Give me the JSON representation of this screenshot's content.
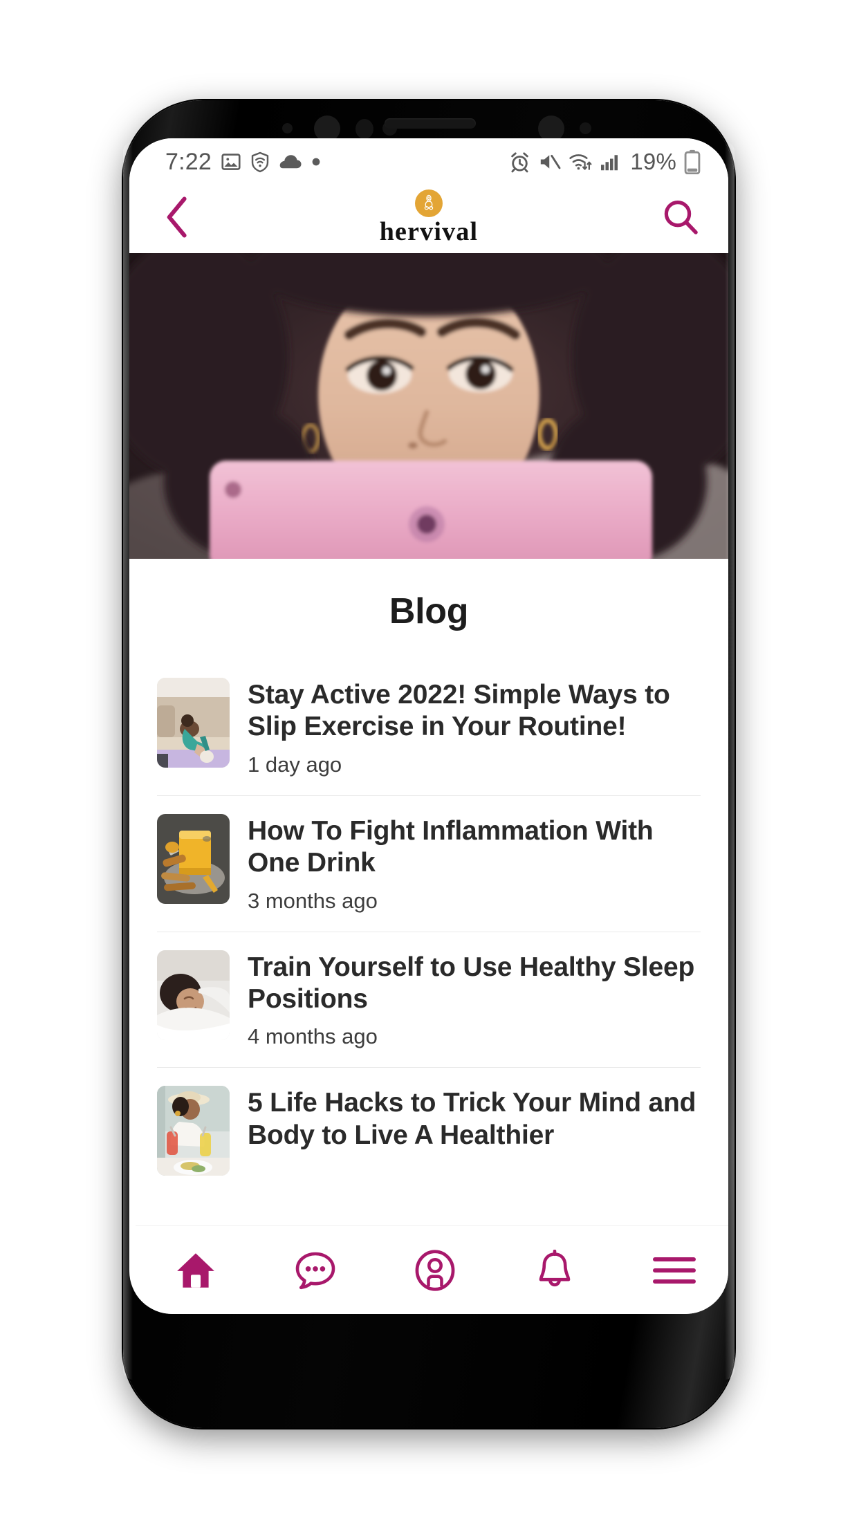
{
  "device": {
    "name": "android-phone"
  },
  "status_bar": {
    "time": "7:22",
    "battery_percent": "19%",
    "left_icons": [
      "screenshot-image-icon",
      "wifi-shield-icon",
      "cloud-icon",
      "dot-icon"
    ],
    "right_icons": [
      "alarm-clock-icon",
      "mute-speaker-icon",
      "wifi-transfer-icon",
      "signal-bars-icon",
      "battery-icon"
    ]
  },
  "header": {
    "back_label": "back-chevron",
    "brand_name": "hervival",
    "logo_name": "meditation-yoga-logo",
    "search_label": "search",
    "accent_color": "#A8186B",
    "logo_color": "#E3A535"
  },
  "hero": {
    "alt": "Woman with curly hair looking at a pink tablet"
  },
  "main": {
    "title": "Blog",
    "posts": [
      {
        "title": "Stay Active 2022! Simple Ways to Slip Exercise in Your Routine!",
        "date": "1 day ago",
        "thumb_alt": "Woman stretching on a yoga mat in a living room"
      },
      {
        "title": "How To Fight Inflammation With One Drink",
        "date": "3 months ago",
        "thumb_alt": "Glass of turmeric drink with cinnamon sticks"
      },
      {
        "title": "Train Yourself to Use Healthy Sleep Positions",
        "date": "4 months ago",
        "thumb_alt": "Woman sleeping in white bedding"
      },
      {
        "title": "5 Life Hacks to Trick Your Mind and Body to Live A Healthier",
        "date": "",
        "thumb_alt": "Woman in a sun hat holding drinks at a table"
      }
    ]
  },
  "bottom_nav": {
    "items": [
      {
        "name": "home",
        "icon": "home-icon",
        "active": true
      },
      {
        "name": "messages",
        "icon": "chat-bubble-icon",
        "active": false
      },
      {
        "name": "profile",
        "icon": "user-circle-icon",
        "active": false
      },
      {
        "name": "notifications",
        "icon": "bell-icon",
        "active": false
      },
      {
        "name": "menu",
        "icon": "hamburger-menu-icon",
        "active": false
      }
    ],
    "color": "#A8186B"
  }
}
